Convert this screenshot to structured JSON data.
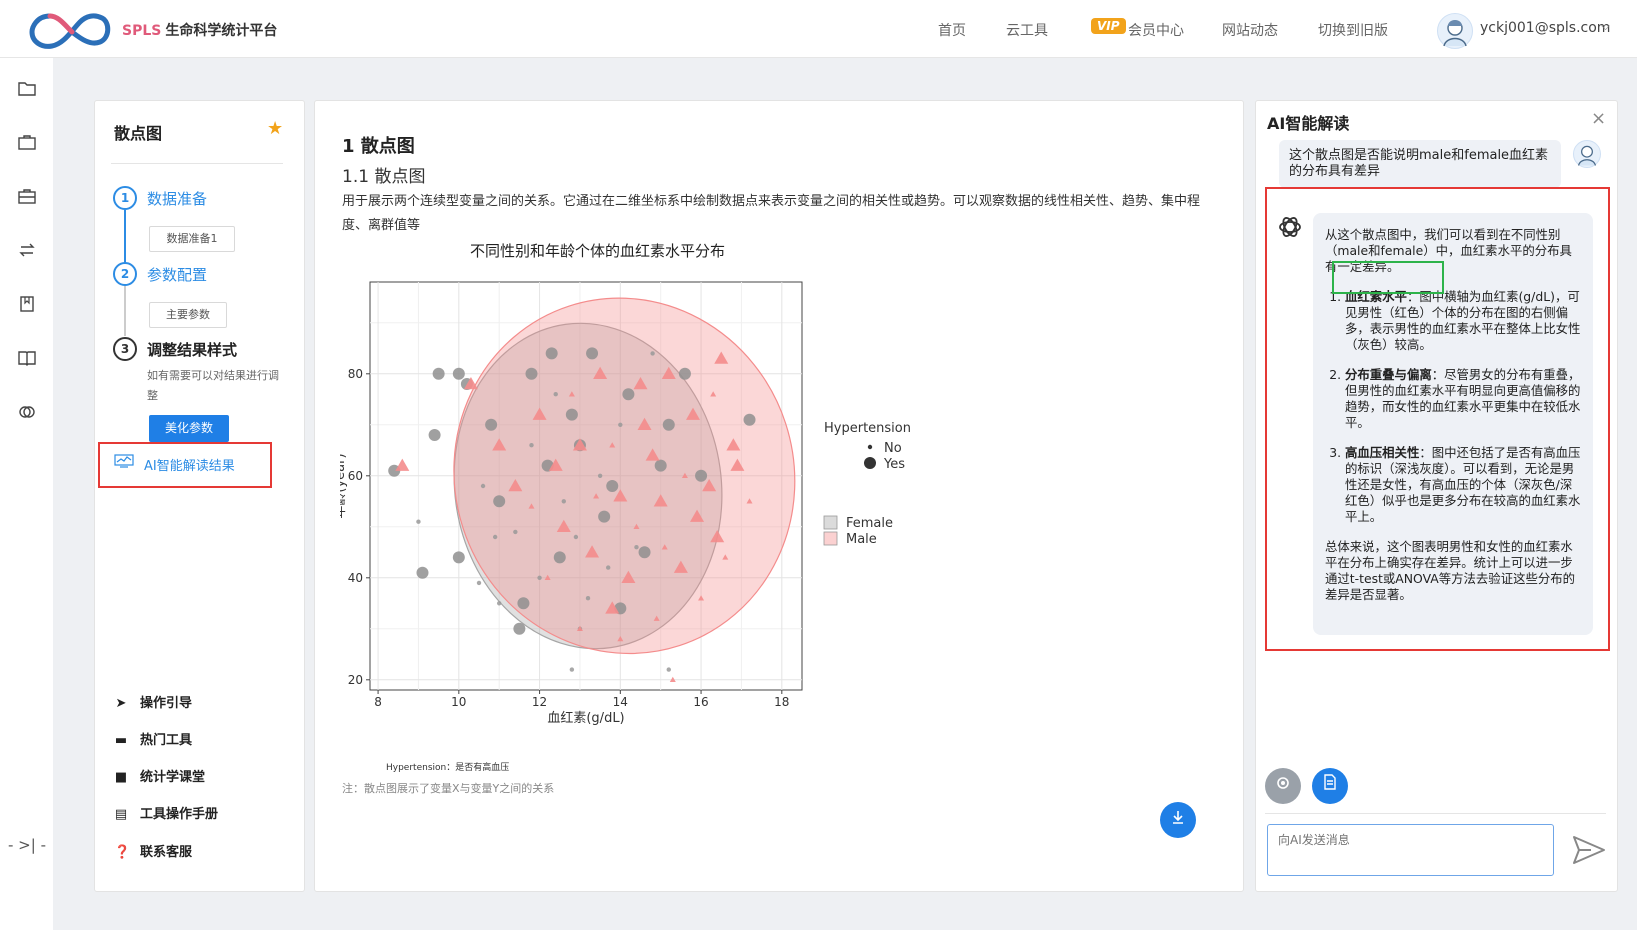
{
  "header": {
    "brand_prefix": "SPLS",
    "brand_name": "生命科学统计平台",
    "nav": [
      "首页",
      "云工具",
      "会员中心",
      "网站动态",
      "切换到旧版"
    ],
    "vip_badge": "VIP",
    "user_email": "yckj001@spls.com",
    "user_chevron": "⌵"
  },
  "rail": {
    "icons": [
      "folder-icon",
      "briefcase-icon",
      "toolbox-icon",
      "exchange-icon",
      "bookmark-icon",
      "book-icon",
      "link-icon"
    ],
    "collapse": "-  >|  -"
  },
  "left_panel": {
    "title": "散点图",
    "steps": [
      {
        "num": "1",
        "label": "数据准备",
        "sub": "数据准备1"
      },
      {
        "num": "2",
        "label": "参数配置",
        "sub": "主要参数"
      },
      {
        "num": "3",
        "label": "调整结果样式",
        "desc": "如有需要可以对结果进行调整",
        "button": "美化参数"
      }
    ],
    "ai_result": "AI智能解读结果",
    "help": [
      "操作引导",
      "热门工具",
      "统计学课堂",
      "工具操作手册",
      "联系客服"
    ]
  },
  "main": {
    "h1": "1 散点图",
    "h2": "1.1 散点图",
    "desc": "用于展示两个连续型变量之间的关系。它通过在二维坐标系中绘制数据点来表示变量之间的相关性或趋势。可以观察数据的线性相关性、趋势、集中程度、离群值等",
    "hypertension_note": "Hypertension：是否有高血压",
    "note": "注：散点图展示了变量X与变量Y之间的关系"
  },
  "chart_data": {
    "type": "scatter",
    "title": "不同性别和年龄个体的血红素水平分布",
    "xlabel": "血红素(g/dL)",
    "ylabel": "年龄(year)",
    "xlim": [
      7.8,
      18.5
    ],
    "ylim": [
      18,
      98
    ],
    "xticks": [
      8,
      10,
      12,
      14,
      16,
      18
    ],
    "yticks": [
      20,
      40,
      60,
      80
    ],
    "grid": true,
    "legend": {
      "size_title": "Hypertension",
      "size_entries": [
        "No",
        "Yes"
      ],
      "color_entries": [
        "Female",
        "Male"
      ],
      "placement": "right"
    },
    "colors": {
      "Female": "#a6a6a6",
      "Male": "#f48c8c"
    },
    "series": [
      {
        "name": "Female",
        "ellipse": {
          "cx": 13.2,
          "cy": 58,
          "rx": 3.3,
          "ry": 32
        },
        "points": [
          {
            "x": 9.5,
            "y": 80,
            "ht": "Yes"
          },
          {
            "x": 10.0,
            "y": 80,
            "ht": "Yes"
          },
          {
            "x": 10.2,
            "y": 78,
            "ht": "Yes"
          },
          {
            "x": 9.4,
            "y": 68,
            "ht": "Yes"
          },
          {
            "x": 8.4,
            "y": 61,
            "ht": "Yes"
          },
          {
            "x": 9.1,
            "y": 41,
            "ht": "Yes"
          },
          {
            "x": 10.0,
            "y": 44,
            "ht": "Yes"
          },
          {
            "x": 11.0,
            "y": 55,
            "ht": "Yes"
          },
          {
            "x": 11.6,
            "y": 35,
            "ht": "Yes"
          },
          {
            "x": 11.5,
            "y": 30,
            "ht": "Yes"
          },
          {
            "x": 12.5,
            "y": 44,
            "ht": "Yes"
          },
          {
            "x": 13.3,
            "y": 84,
            "ht": "Yes"
          },
          {
            "x": 14.2,
            "y": 76,
            "ht": "Yes"
          },
          {
            "x": 15.2,
            "y": 70,
            "ht": "Yes"
          },
          {
            "x": 16.0,
            "y": 60,
            "ht": "Yes"
          },
          {
            "x": 12.2,
            "y": 62,
            "ht": "Yes"
          },
          {
            "x": 13.6,
            "y": 52,
            "ht": "Yes"
          },
          {
            "x": 14.6,
            "y": 45,
            "ht": "Yes"
          },
          {
            "x": 12.8,
            "y": 72,
            "ht": "Yes"
          },
          {
            "x": 14.0,
            "y": 34,
            "ht": "Yes"
          },
          {
            "x": 17.2,
            "y": 71,
            "ht": "Yes"
          },
          {
            "x": 15.6,
            "y": 80,
            "ht": "Yes"
          },
          {
            "x": 11.8,
            "y": 80,
            "ht": "Yes"
          },
          {
            "x": 13.0,
            "y": 66,
            "ht": "Yes"
          },
          {
            "x": 10.8,
            "y": 70,
            "ht": "Yes"
          },
          {
            "x": 13.8,
            "y": 58,
            "ht": "Yes"
          },
          {
            "x": 15.0,
            "y": 62,
            "ht": "Yes"
          },
          {
            "x": 12.3,
            "y": 84,
            "ht": "Yes"
          },
          {
            "x": 9.0,
            "y": 51,
            "ht": "No"
          },
          {
            "x": 10.5,
            "y": 39,
            "ht": "No"
          },
          {
            "x": 11.0,
            "y": 35,
            "ht": "No"
          },
          {
            "x": 12.8,
            "y": 22,
            "ht": "No"
          },
          {
            "x": 11.4,
            "y": 49,
            "ht": "No"
          },
          {
            "x": 13.0,
            "y": 30,
            "ht": "No"
          },
          {
            "x": 14.4,
            "y": 46,
            "ht": "No"
          },
          {
            "x": 12.6,
            "y": 55,
            "ht": "No"
          },
          {
            "x": 13.5,
            "y": 60,
            "ht": "No"
          },
          {
            "x": 15.2,
            "y": 22,
            "ht": "No"
          },
          {
            "x": 14.8,
            "y": 84,
            "ht": "No"
          },
          {
            "x": 10.6,
            "y": 58,
            "ht": "No"
          },
          {
            "x": 12.0,
            "y": 40,
            "ht": "No"
          },
          {
            "x": 13.2,
            "y": 36,
            "ht": "No"
          },
          {
            "x": 11.8,
            "y": 66,
            "ht": "No"
          },
          {
            "x": 14.0,
            "y": 70,
            "ht": "No"
          },
          {
            "x": 12.4,
            "y": 76,
            "ht": "No"
          },
          {
            "x": 10.9,
            "y": 48,
            "ht": "No"
          },
          {
            "x": 13.7,
            "y": 42,
            "ht": "No"
          },
          {
            "x": 12.9,
            "y": 48,
            "ht": "No"
          }
        ]
      },
      {
        "name": "Male",
        "ellipse": {
          "cx": 14.1,
          "cy": 60,
          "rx": 4.2,
          "ry": 35
        },
        "points": [
          {
            "x": 8.6,
            "y": 62,
            "ht": "Yes"
          },
          {
            "x": 10.3,
            "y": 78,
            "ht": "Yes"
          },
          {
            "x": 16.5,
            "y": 83,
            "ht": "Yes"
          },
          {
            "x": 16.9,
            "y": 62,
            "ht": "Yes"
          },
          {
            "x": 16.4,
            "y": 48,
            "ht": "Yes"
          },
          {
            "x": 15.0,
            "y": 55,
            "ht": "Yes"
          },
          {
            "x": 13.8,
            "y": 34,
            "ht": "Yes"
          },
          {
            "x": 15.8,
            "y": 72,
            "ht": "Yes"
          },
          {
            "x": 14.5,
            "y": 78,
            "ht": "Yes"
          },
          {
            "x": 12.0,
            "y": 72,
            "ht": "Yes"
          },
          {
            "x": 13.0,
            "y": 66,
            "ht": "Yes"
          },
          {
            "x": 14.8,
            "y": 64,
            "ht": "Yes"
          },
          {
            "x": 16.2,
            "y": 58,
            "ht": "Yes"
          },
          {
            "x": 15.5,
            "y": 42,
            "ht": "Yes"
          },
          {
            "x": 11.4,
            "y": 58,
            "ht": "Yes"
          },
          {
            "x": 12.6,
            "y": 50,
            "ht": "Yes"
          },
          {
            "x": 14.2,
            "y": 40,
            "ht": "Yes"
          },
          {
            "x": 16.8,
            "y": 66,
            "ht": "Yes"
          },
          {
            "x": 13.5,
            "y": 80,
            "ht": "Yes"
          },
          {
            "x": 15.2,
            "y": 80,
            "ht": "Yes"
          },
          {
            "x": 11.0,
            "y": 66,
            "ht": "Yes"
          },
          {
            "x": 14.0,
            "y": 56,
            "ht": "Yes"
          },
          {
            "x": 15.9,
            "y": 52,
            "ht": "Yes"
          },
          {
            "x": 12.4,
            "y": 62,
            "ht": "Yes"
          },
          {
            "x": 13.3,
            "y": 45,
            "ht": "Yes"
          },
          {
            "x": 14.6,
            "y": 70,
            "ht": "Yes"
          },
          {
            "x": 17.2,
            "y": 55,
            "ht": "No"
          },
          {
            "x": 16.0,
            "y": 36,
            "ht": "No"
          },
          {
            "x": 14.9,
            "y": 32,
            "ht": "No"
          },
          {
            "x": 15.3,
            "y": 20,
            "ht": "No"
          },
          {
            "x": 13.0,
            "y": 30,
            "ht": "No"
          },
          {
            "x": 12.2,
            "y": 40,
            "ht": "No"
          },
          {
            "x": 16.6,
            "y": 44,
            "ht": "No"
          },
          {
            "x": 15.6,
            "y": 60,
            "ht": "No"
          },
          {
            "x": 13.8,
            "y": 66,
            "ht": "No"
          },
          {
            "x": 12.8,
            "y": 76,
            "ht": "No"
          },
          {
            "x": 14.4,
            "y": 50,
            "ht": "No"
          },
          {
            "x": 11.8,
            "y": 54,
            "ht": "No"
          },
          {
            "x": 16.3,
            "y": 76,
            "ht": "No"
          },
          {
            "x": 15.1,
            "y": 46,
            "ht": "No"
          },
          {
            "x": 13.4,
            "y": 56,
            "ht": "No"
          },
          {
            "x": 14.0,
            "y": 28,
            "ht": "No"
          }
        ]
      }
    ]
  },
  "ai_panel": {
    "title": "AI智能解读",
    "close": "×",
    "question": "这个散点图是否能说明male和female血红素的分布具有差异",
    "answer_intro": "从这个散点图中，我们可以看到在不同性别（male和female）中，血红素水平的分布具有一定差异。",
    "points": [
      {
        "head": "血红素水平",
        "body": "：图中横轴为血红素(g/dL)，可见男性（红色）个体的分布在图的右侧偏多，表示男性的血红素水平在整体上比女性（灰色）较高。"
      },
      {
        "head": "分布重叠与偏离",
        "body": "：尽管男女的分布有重叠，但男性的血红素水平有明显向更高值偏移的趋势，而女性的血红素水平更集中在较低水平。"
      },
      {
        "head": "高血压相关性",
        "body": "：图中还包括了是否有高血压的标识（深浅灰度）。可以看到，无论是男性还是女性，有高血压的个体（深灰色/深红色）似乎也是更多分布在较高的血红素水平上。"
      }
    ],
    "answer_outro": "总体来说，这个图表明男性和女性的血红素水平在分布上确实存在差异。统计上可以进一步通过t-test或ANOVA等方法去验证这些分布的差异是否显著。",
    "input_placeholder": "向AI发送消息"
  }
}
